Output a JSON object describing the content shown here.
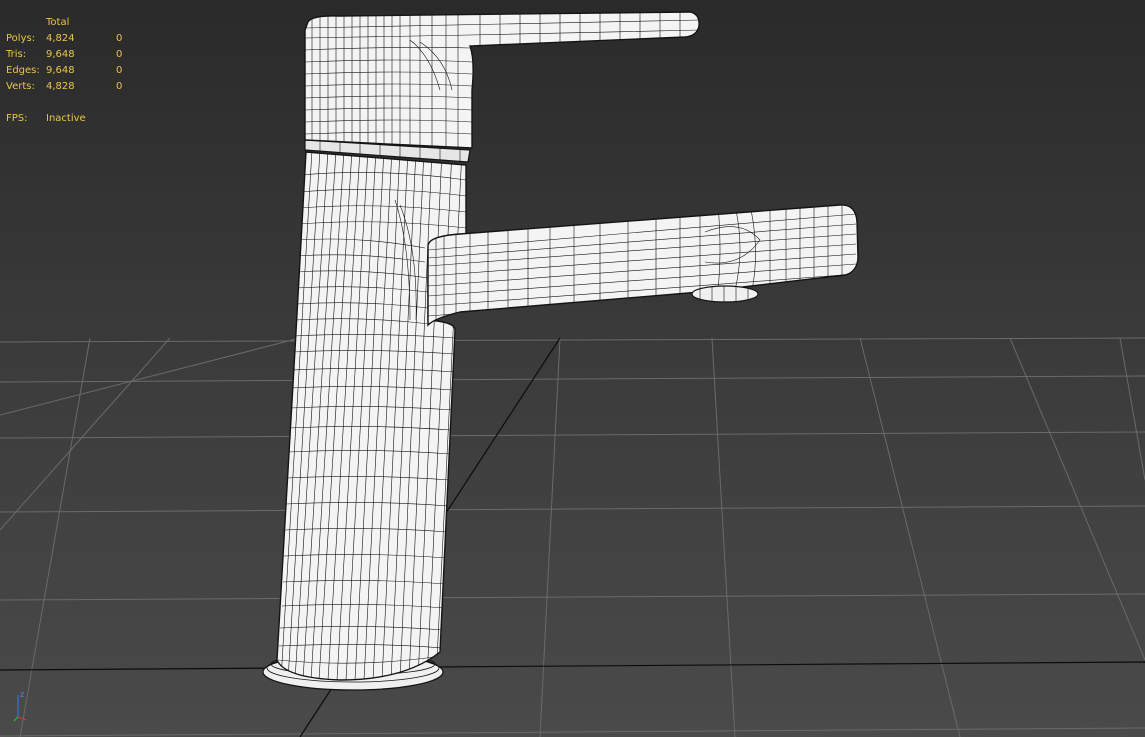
{
  "stats": {
    "header": "Total",
    "rows": [
      {
        "label": "Polys:",
        "total": "4,824",
        "selected": "0"
      },
      {
        "label": "Tris:",
        "total": "9,648",
        "selected": "0"
      },
      {
        "label": "Edges:",
        "total": "9,648",
        "selected": "0"
      },
      {
        "label": "Verts:",
        "total": "4,828",
        "selected": "0"
      }
    ],
    "fps_label": "FPS:",
    "fps_value": "Inactive"
  },
  "gizmo": {
    "axis_label": "z"
  },
  "colors": {
    "stats_text": "#e8c64a",
    "grid_line": "#6a6a6a",
    "grid_axis": "#0c0c0c",
    "mesh_fill": "#f4f4f4",
    "mesh_wire": "#141414"
  },
  "scene": {
    "view": "Perspective",
    "display_mode": "Edged Faces",
    "object": "faucet"
  }
}
